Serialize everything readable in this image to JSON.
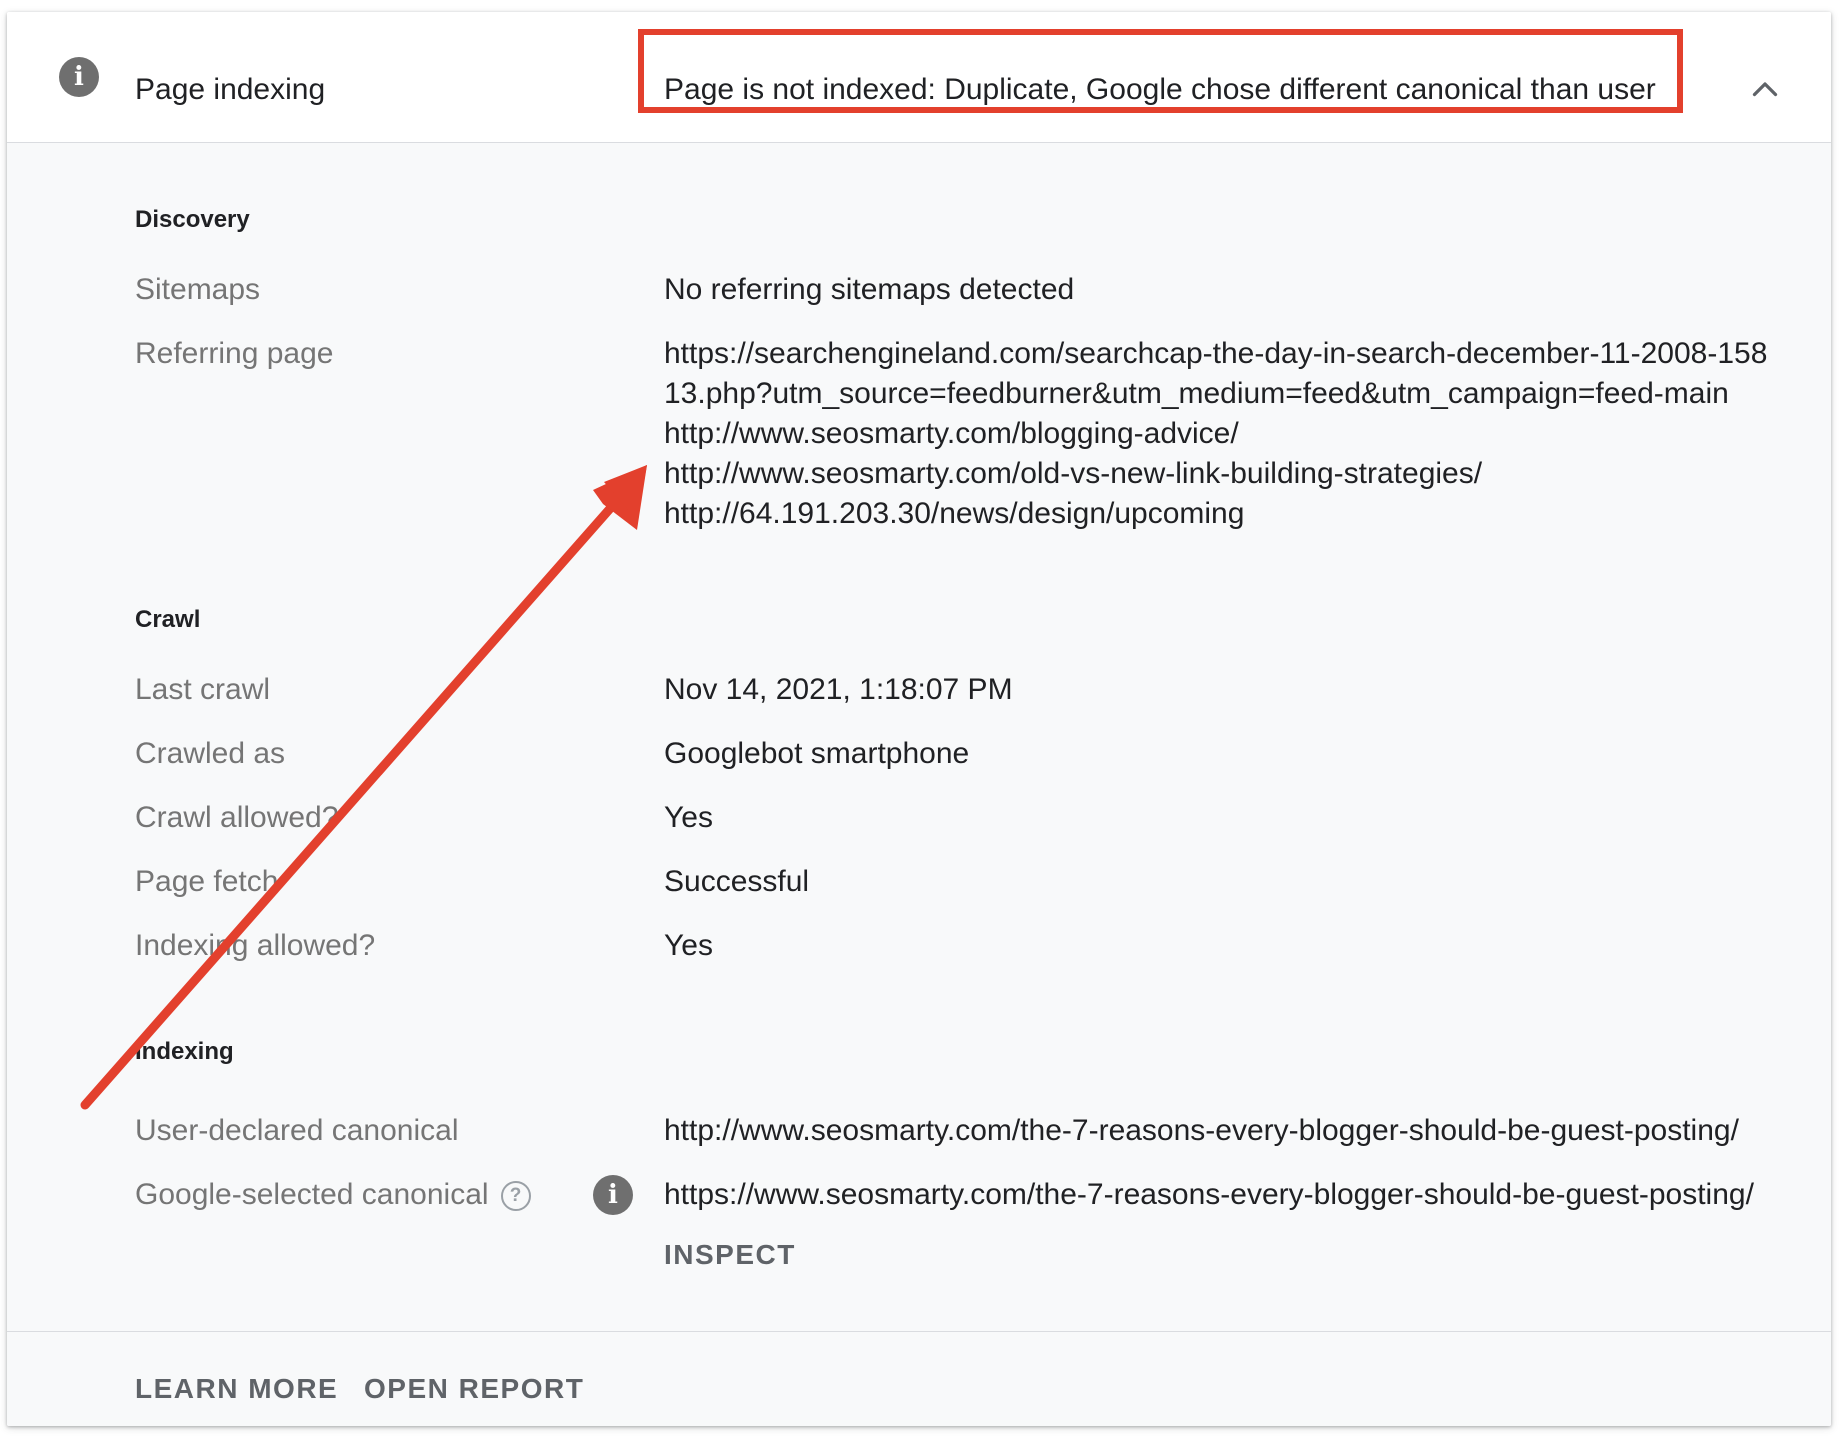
{
  "header": {
    "title": "Page indexing",
    "status": "Page is not indexed: Duplicate, Google chose different canonical than user"
  },
  "discovery": {
    "section_title": "Discovery",
    "sitemaps_label": "Sitemaps",
    "sitemaps_value": "No referring sitemaps detected",
    "referring_label": "Referring page",
    "referring_pages": [
      "https://searchengineland.com/searchcap-the-day-in-search-december-11-2008-158",
      "13.php?utm_source=feedburner&utm_medium=feed&utm_campaign=feed-main",
      "http://www.seosmarty.com/blogging-advice/",
      "http://www.seosmarty.com/old-vs-new-link-building-strategies/",
      "http://64.191.203.30/news/design/upcoming"
    ]
  },
  "crawl": {
    "section_title": "Crawl",
    "last_crawl_label": "Last crawl",
    "last_crawl_value": "Nov 14, 2021, 1:18:07 PM",
    "crawled_as_label": "Crawled as",
    "crawled_as_value": "Googlebot smartphone",
    "crawl_allowed_label": "Crawl allowed?",
    "crawl_allowed_value": "Yes",
    "page_fetch_label": "Page fetch",
    "page_fetch_value": "Successful",
    "indexing_allowed_label": "Indexing allowed?",
    "indexing_allowed_value": "Yes"
  },
  "indexing": {
    "section_title": "Indexing",
    "user_canonical_label": "User-declared canonical",
    "user_canonical_value": "http://www.seosmarty.com/the-7-reasons-every-blogger-should-be-guest-posting/",
    "google_canonical_label": "Google-selected canonical",
    "google_canonical_value": "https://www.seosmarty.com/the-7-reasons-every-blogger-should-be-guest-posting/",
    "inspect_label": "INSPECT"
  },
  "footer": {
    "learn_more": "LEARN MORE",
    "open_report": "OPEN REPORT"
  },
  "icons": {
    "info": "info-icon",
    "help": "help-icon",
    "collapse": "chevron-up-icon"
  },
  "colors": {
    "annotation": "#e3402d",
    "muted_text": "#757575",
    "panel_bg": "#f8f9fa"
  }
}
